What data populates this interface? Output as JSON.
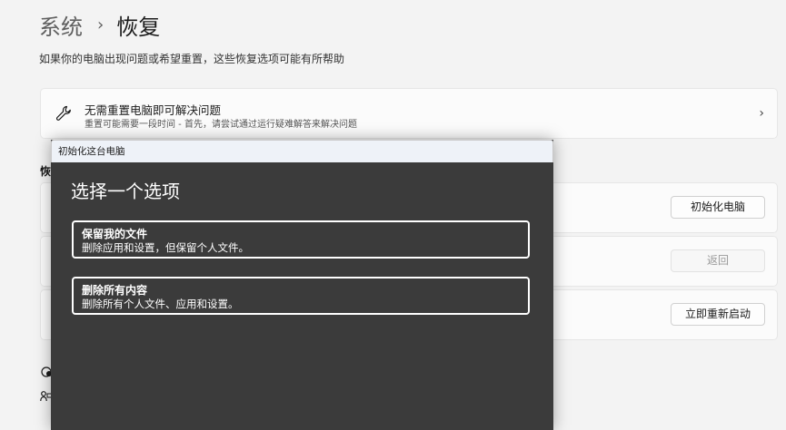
{
  "breadcrumb": {
    "parent": "系统",
    "separator": "›",
    "current": "恢复"
  },
  "subtitle": "如果你的电脑出现问题或希望重置，这些恢复选项可能有所帮助",
  "fix_card": {
    "title": "无需重置电脑即可解决问题",
    "description": "重置可能需要一段时间 - 首先，请尝试通过运行疑难解答来解决问题"
  },
  "section_label": "恢",
  "buttons": {
    "reset": "初始化电脑",
    "back": "返回",
    "restart": "立即重新启动"
  },
  "dialog": {
    "title": "初始化这台电脑",
    "heading": "选择一个选项",
    "options": [
      {
        "title": "保留我的文件",
        "description": "删除应用和设置，但保留个人文件。"
      },
      {
        "title": "删除所有内容",
        "description": "删除所有个人文件、应用和设置。"
      }
    ]
  },
  "icons": [
    "wrench-icon",
    "chevron-right-icon",
    "help-icon",
    "feedback-icon"
  ]
}
